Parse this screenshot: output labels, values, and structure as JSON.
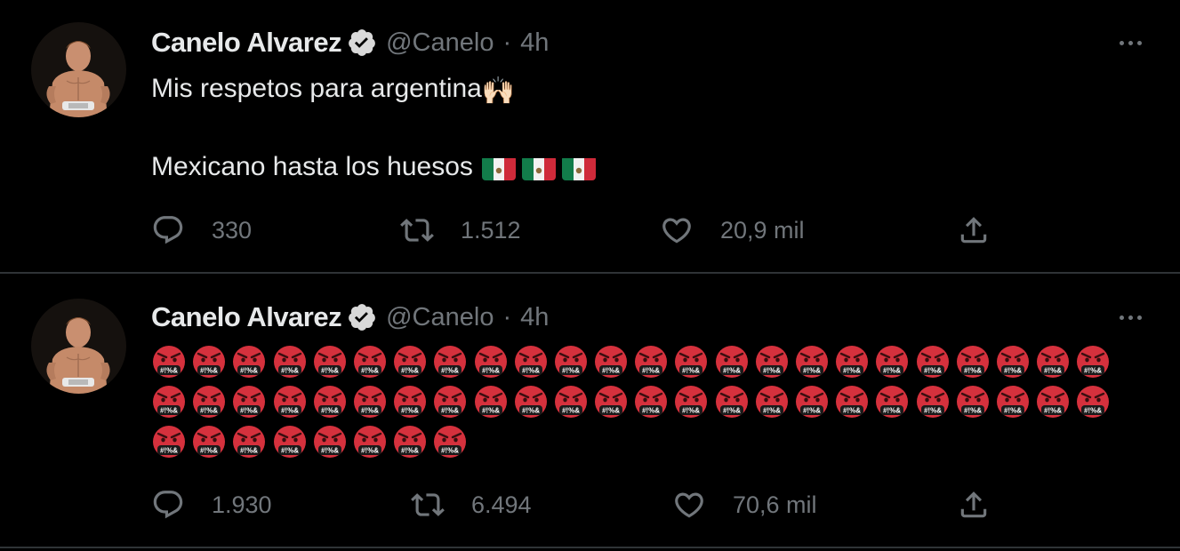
{
  "colors": {
    "background": "#000000",
    "text": "#e7e9ea",
    "muted": "#71767b",
    "divider": "#2f3336",
    "verified_badge": "#d9d9d9"
  },
  "tweets": [
    {
      "author": "Canelo Alvarez",
      "handle": "@Canelo",
      "separator": "·",
      "time": "4h",
      "text_line_1": "Mis respetos para argentina",
      "text_line_1_emoji": "🙌🏻",
      "text_line_2": "Mexicano hasta los huesos",
      "text_line_2_emoji": "🇲🇽🇲🇽🇲🇽",
      "reply_count": "330",
      "retweet_count": "1.512",
      "like_count": "20,9 mil"
    },
    {
      "author": "Canelo Alvarez",
      "handle": "@Canelo",
      "separator": "·",
      "time": "4h",
      "emoji_text": "🤬🤬🤬🤬🤬🤬🤬🤬🤬🤬🤬🤬🤬🤬🤬🤬🤬🤬🤬🤬🤬🤬🤬🤬🤬🤬🤬🤬🤬🤬🤬🤬🤬🤬🤬🤬🤬🤬🤬🤬🤬🤬🤬🤬🤬🤬🤬🤬🤬🤬🤬🤬🤬🤬🤬🤬",
      "emoji_rows": [
        24,
        24,
        8
      ],
      "reply_count": "1.930",
      "retweet_count": "6.494",
      "like_count": "70,6 mil"
    }
  ],
  "icons": {
    "verified": "verified-badge-icon",
    "more": "more-icon",
    "reply": "reply-icon",
    "retweet": "retweet-icon",
    "like": "heart-icon",
    "share": "share-icon",
    "raised_hands": "raised-hands-emoji",
    "mexico_flag": "mexico-flag-emoji",
    "angry_face": "face-with-symbols-on-mouth-emoji"
  }
}
